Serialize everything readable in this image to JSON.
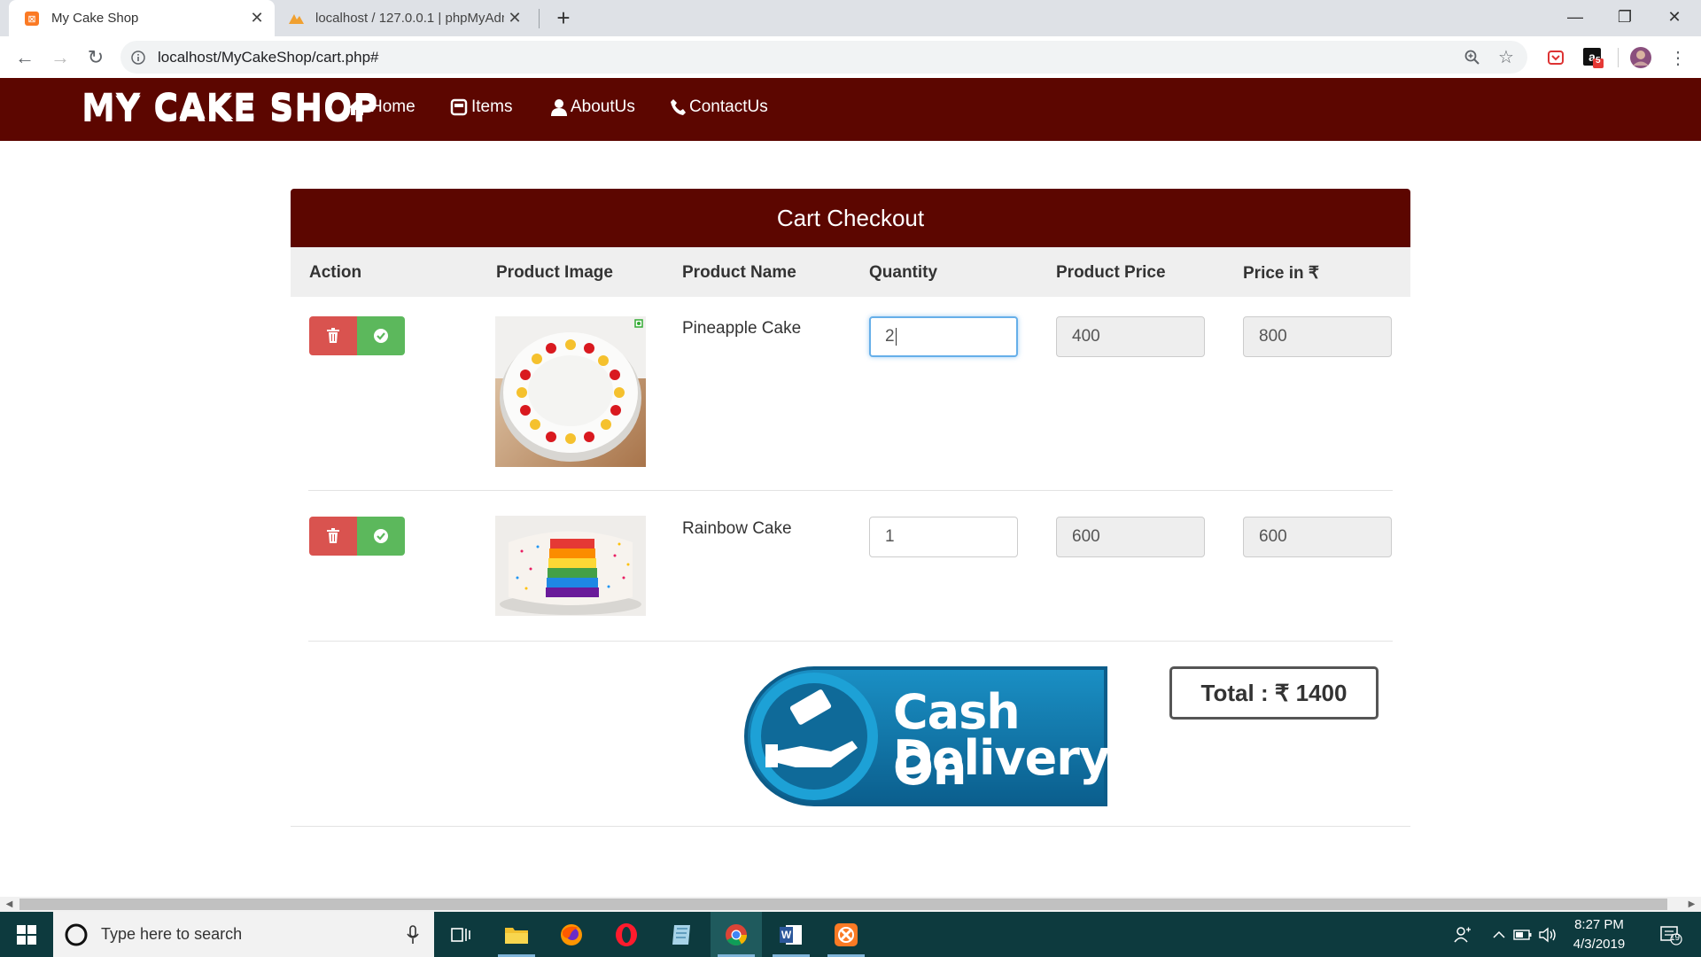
{
  "browser": {
    "tabs": [
      {
        "title": "My Cake Shop",
        "active": true
      },
      {
        "title": "localhost / 127.0.0.1 | phpMyAdm",
        "active": false
      }
    ],
    "url": "localhost/MyCakeShop/cart.php#",
    "extension_badge": "5"
  },
  "navbar": {
    "brand": "MY CAKE SHOP",
    "links": [
      {
        "label": "Home",
        "icon": "home-icon"
      },
      {
        "label": "Items",
        "icon": "items-icon"
      },
      {
        "label": "AboutUs",
        "icon": "user-icon"
      },
      {
        "label": "ContactUs",
        "icon": "phone-icon"
      }
    ]
  },
  "cart": {
    "title": "Cart Checkout",
    "columns": [
      "Action",
      "Product Image",
      "Product Name",
      "Quantity",
      "Product Price",
      "Price in ₹"
    ],
    "rows": [
      {
        "name": "Pineapple Cake",
        "quantity": "2",
        "price": "400",
        "line_total": "800",
        "image": "pineapple-cake-image"
      },
      {
        "name": "Rainbow Cake",
        "quantity": "1",
        "price": "600",
        "line_total": "600",
        "image": "rainbow-cake-image"
      }
    ],
    "payment_button": {
      "line1": "Cash On",
      "line2": "Delivery"
    },
    "total": "Total : ₹ 1400"
  },
  "taskbar": {
    "search_placeholder": "Type here to search",
    "time": "8:27 PM",
    "date": "4/3/2019",
    "notification_count": "19"
  },
  "colors": {
    "brand": "#5c0600",
    "delete": "#d9534f",
    "confirm": "#5cb85c",
    "taskbar": "#0d3a3e"
  }
}
